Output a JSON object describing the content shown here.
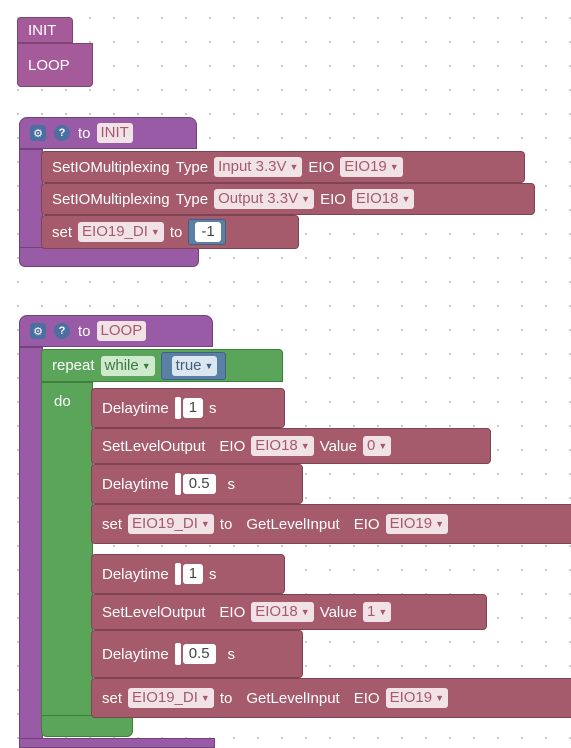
{
  "launcher": {
    "init_label": "INIT",
    "loop_label": "LOOP"
  },
  "init_proc": {
    "to_label": "to",
    "name": "INIT",
    "blocks": [
      {
        "label": "SetIOMultiplexing",
        "type_label": "Type",
        "type_value": "Input 3.3V",
        "eio_label": "EIO",
        "eio_value": "EIO19"
      },
      {
        "label": "SetIOMultiplexing",
        "type_label": "Type",
        "type_value": "Output 3.3V",
        "eio_label": "EIO",
        "eio_value": "EIO18"
      }
    ],
    "set_block": {
      "set_label": "set",
      "var": "EIO19_DI",
      "to_label": "to",
      "value": "-1"
    }
  },
  "loop_proc": {
    "to_label": "to",
    "name": "LOOP",
    "repeat_label": "repeat",
    "repeat_mode": "while",
    "condition": "true",
    "do_label": "do",
    "delay_label": "Delaytime",
    "unit": "s",
    "setlevel_label": "SetLevelOutput",
    "eio_label": "EIO",
    "value_label": "Value",
    "set_label": "set",
    "to2_label": "to",
    "getlevel_label": "GetLevelInput",
    "var": "EIO19_DI",
    "eio18": "EIO18",
    "eio19": "EIO19",
    "delay1": "1",
    "delay2": "0.5",
    "value0": "0",
    "value1": "1"
  }
}
